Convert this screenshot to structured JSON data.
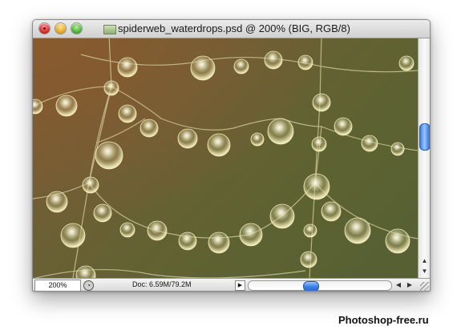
{
  "window": {
    "title": "spiderweb_waterdrops.psd @ 200% (BIG, RGB/8)",
    "close_icon": "close-icon",
    "minimize_icon": "minimize-icon",
    "zoom_icon": "zoom-icon"
  },
  "canvas": {
    "description_icon": "spiderweb-waterdrops-image"
  },
  "statusbar": {
    "zoom_level": "200%",
    "doc_info": "Doc: 6.59M/79.2M",
    "play_icon": "▶",
    "left_arrow": "◀",
    "right_arrow": "▶"
  },
  "scrollbars": {
    "up_arrow": "▲",
    "down_arrow": "▼"
  },
  "watermark": "Photoshop-free.ru"
}
